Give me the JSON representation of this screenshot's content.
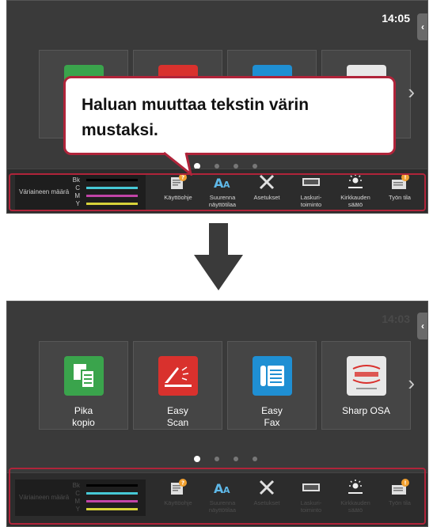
{
  "before": {
    "clock": "14:05",
    "callout_text": "Haluan muuttaa tekstin värin mustaksi."
  },
  "after": {
    "clock": "14:03"
  },
  "side_tab_icon": "chevron-left-icon",
  "tiles": [
    {
      "label": "Pika\nkopio",
      "icon": "copy-icon",
      "color": "#3aa44c"
    },
    {
      "label": "Easy\nScan",
      "icon": "scan-icon",
      "color": "#d9312d"
    },
    {
      "label": "Easy\nFax",
      "icon": "fax-icon",
      "color": "#1f8fd3"
    },
    {
      "label": "Sharp OSA",
      "icon": "osa-icon",
      "color": "#e8e8e8"
    }
  ],
  "toner": {
    "title": "Väriaineen määrä",
    "rows": [
      {
        "code": "Bk",
        "color": "#000000"
      },
      {
        "code": "C",
        "color": "#46c9d6"
      },
      {
        "code": "M",
        "color": "#c144a6"
      },
      {
        "code": "Y",
        "color": "#d7d23a"
      }
    ]
  },
  "dock": [
    {
      "label": "Käyttöohje",
      "icon": "manual-icon"
    },
    {
      "label": "Suurenna\nnäyttötilaa",
      "icon": "enlarge-text-icon"
    },
    {
      "label": "Asetukset",
      "icon": "settings-tools-icon"
    },
    {
      "label": "Laskuri-\ntoiminto",
      "icon": "counter-icon"
    },
    {
      "label": "Kirkkauden\nsäätö",
      "icon": "brightness-icon"
    },
    {
      "label": "Työn tila",
      "icon": "job-status-icon"
    }
  ],
  "colors": {
    "highlight": "#b0243a",
    "screen_bg": "#3a3a3a"
  }
}
